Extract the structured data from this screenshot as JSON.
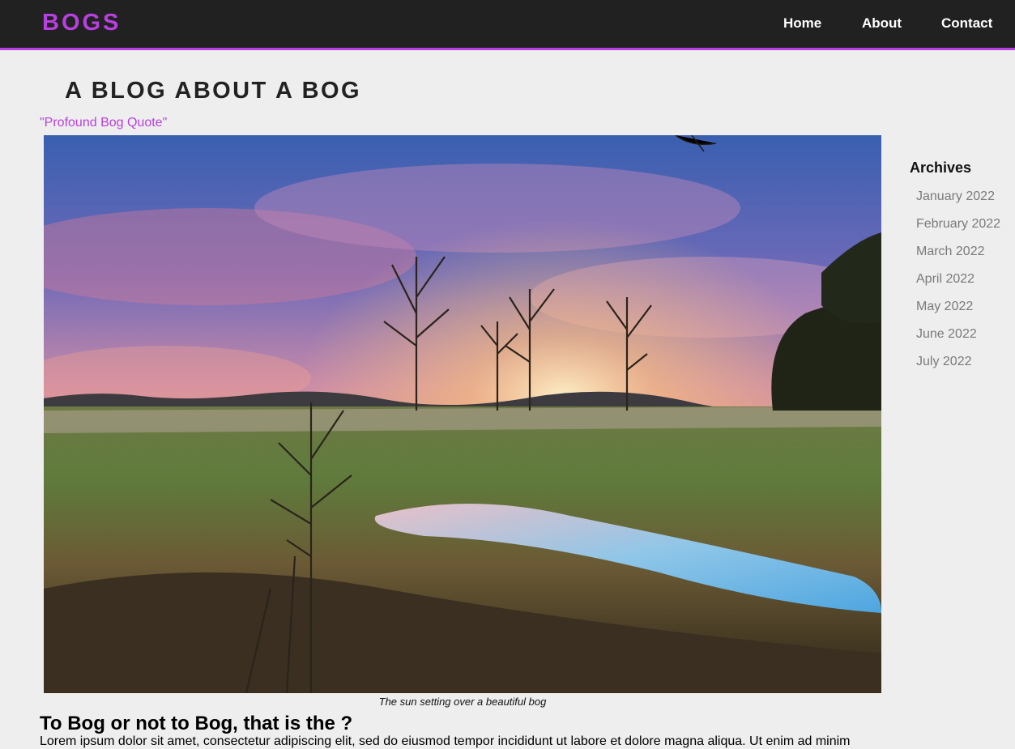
{
  "nav": {
    "brand": "BOGS",
    "links": [
      "Home",
      "About",
      "Contact"
    ],
    "accent_color": "#b83fe0"
  },
  "header": {
    "title": "A BLOG ABOUT A BOG",
    "quote": "\"Profound Bog Quote\""
  },
  "hero": {
    "caption": "The sun setting over a beautiful bog"
  },
  "post": {
    "heading": "To Bog or not to Bog, that is the ?",
    "body": "Lorem ipsum dolor sit amet, consectetur adipiscing elit, sed do eiusmod tempor incididunt ut labore et dolore magna aliqua. Ut enim ad minim"
  },
  "sidebar": {
    "title": "Archives",
    "items": [
      "January 2022",
      "February 2022",
      "March 2022",
      "April 2022",
      "May 2022",
      "June 2022",
      "July 2022"
    ]
  }
}
